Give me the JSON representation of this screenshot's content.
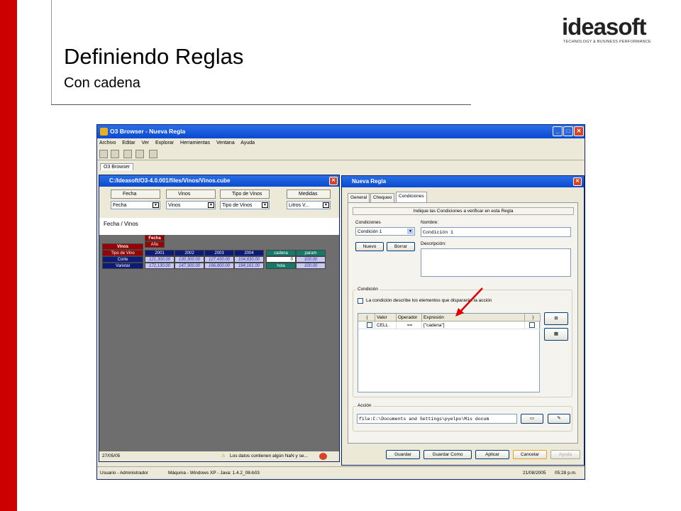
{
  "slide": {
    "title": "Definiendo Reglas",
    "subtitle": "Con cadena",
    "logo_text": "ideasoft",
    "logo_tagline": "TECHNOLOGY & BUSINESS PERFORMANCE",
    "colors": {
      "accent": "#cc0000",
      "titlebar": "#0a4ad0"
    }
  },
  "app": {
    "window_title": "O3 Browser - Nueva Regla",
    "menu": [
      "Archivo",
      "Editar",
      "Ver",
      "Explorar",
      "Herramientas",
      "Ventana",
      "Ayuda"
    ],
    "tab": "O3 Browser",
    "statusbar": {
      "user": "Usuario - Administrador",
      "machine": "Máquina - Windows XP - Java: 1.4.2_08-b03",
      "date": "21/08/2005",
      "time": "05:28 p.m."
    }
  },
  "cube": {
    "title": "C:/Ideasoft/O3-4.0.001/files/Vinos/Vinos.cube",
    "dimensions": [
      {
        "name": "Fecha",
        "value": "Fecha"
      },
      {
        "name": "Vinos",
        "value": "Vinos"
      },
      {
        "name": "Tipo de Vinos",
        "value": "Tipo de Vinos"
      },
      {
        "name": "Medidas",
        "value": "Litros V..."
      }
    ],
    "view_label": "Fecha / Vinos",
    "row_dim": "Vinos",
    "col_dim": "Fecha",
    "col_level": "Año",
    "row_level": "Tipo de Vino",
    "years": [
      "2001",
      "2002",
      "2003",
      "2004"
    ],
    "extra_cols": [
      "cadena",
      "param"
    ],
    "rows": [
      {
        "label": "Corte",
        "values": [
          "121,300.00",
          "130,300.00",
          "127,430.00",
          "104,830.00"
        ],
        "cadena": "0",
        "param": "100.00"
      },
      {
        "label": "Varietal",
        "values": [
          "172,130.00",
          "147,300.00",
          "166,800.00",
          "184,161.00"
        ],
        "cadena": "hola",
        "param": "100.00"
      }
    ],
    "status_date": "27/05/05",
    "warning": "Los datos contienen algún NaN y se..."
  },
  "dialog": {
    "title": "Nueva Regla",
    "tabs": [
      "General",
      "Chequeo",
      "Condiciones"
    ],
    "instruction": "Indique las Condiciones a verificar en esta Regla",
    "conditions_label": "Condiciones",
    "condition_selected": "Condición 1",
    "name_label": "Nombre:",
    "name_value": "Condición 1",
    "new_button": "Nuevo",
    "delete_button": "Borrar",
    "description_label": "Descripción:",
    "condition_group": "Condición",
    "condition_check_label": "La condición describe los elementos que dispararán la acción",
    "table_headers": [
      "(",
      "Valor",
      "Operador",
      "Expresión",
      ")"
    ],
    "table_row": {
      "open": "",
      "valor": "CELL",
      "operador": "==",
      "expresion": "[\"cadena\"]",
      "close": ""
    },
    "action_group": "Acción",
    "action_value": "file:C:\\Documents and Settings\\pyelpo\\Mis docum",
    "buttons": [
      "Guardar",
      "Guardar Como",
      "Aplicar",
      "Cancelar",
      "Ayuda"
    ]
  }
}
